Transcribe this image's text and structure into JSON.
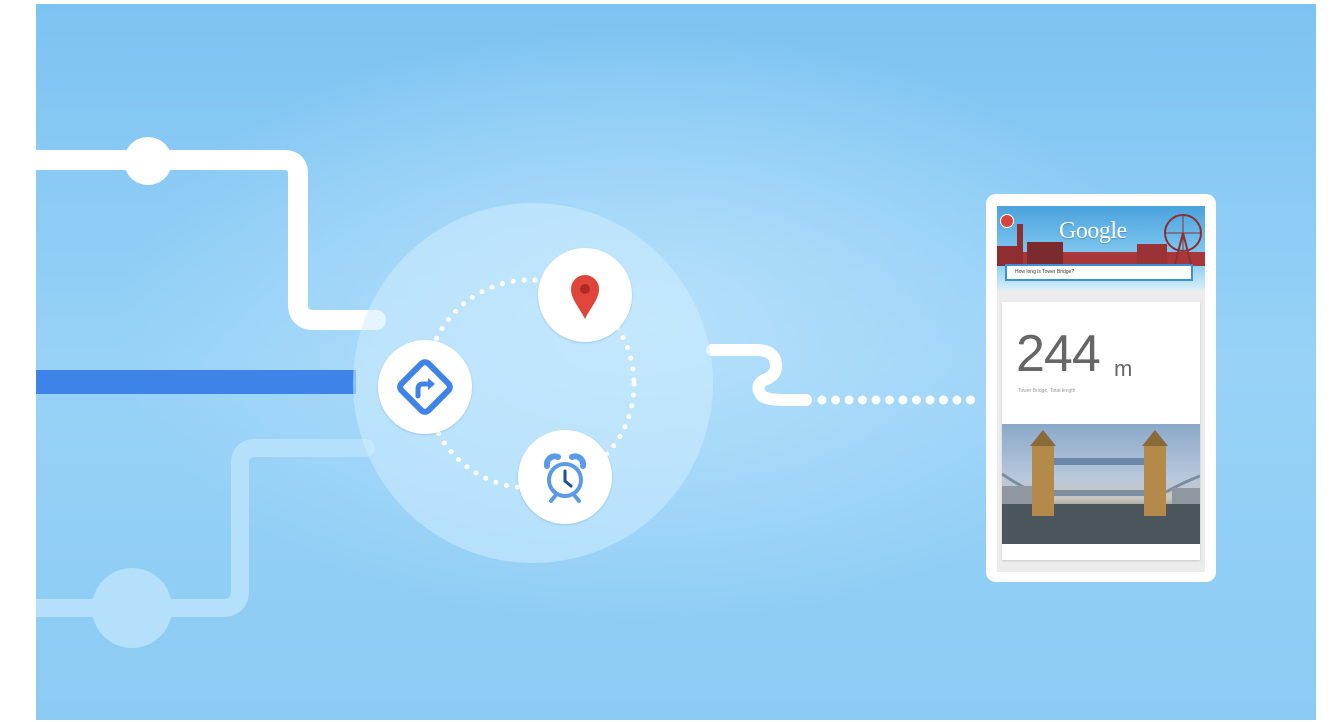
{
  "colors": {
    "background": "#8ccbf4",
    "connector_white": "#ffffff",
    "connector_blue": "#3d83e8",
    "connector_light": "#b5e0fb",
    "map_pin": "#e0453a",
    "directions_blue": "#3d83e8",
    "alarm_blue": "#5a9ae6"
  },
  "icons": {
    "hub": [
      "map-pin-icon",
      "directions-icon",
      "alarm-clock-icon"
    ],
    "phone": [
      "microphone-icon",
      "ferris-wheel-icon"
    ]
  },
  "phone": {
    "logo": "Google",
    "search_query": "How long is Tower Bridge?",
    "answer_value": "244",
    "answer_unit": "m",
    "answer_caption": "Tower Bridge, Total length"
  }
}
